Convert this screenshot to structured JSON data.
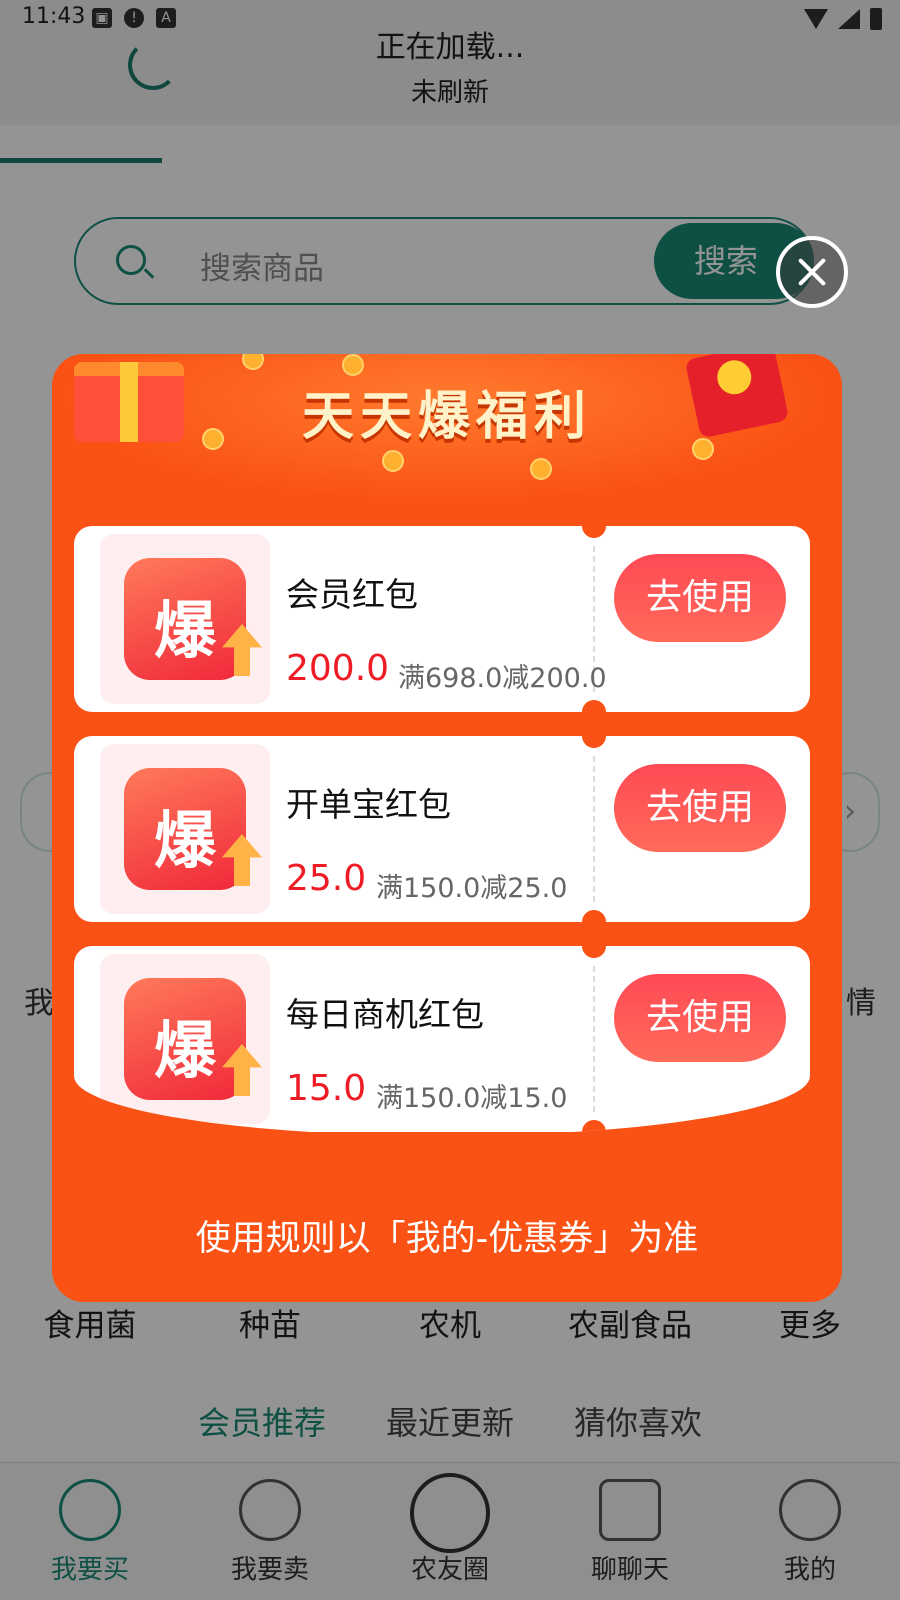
{
  "status_bar": {
    "time": "11:43"
  },
  "refresh": {
    "title": "正在加载...",
    "subtitle": "未刷新"
  },
  "search": {
    "placeholder": "搜索商品",
    "button_label": "搜索"
  },
  "background_labels": {
    "left": "我",
    "right": "情"
  },
  "categories": [
    "食用菌",
    "种苗",
    "农机",
    "农副食品",
    "更多"
  ],
  "sub_tabs": [
    {
      "label": "会员推荐",
      "active": true
    },
    {
      "label": "最近更新",
      "active": false
    },
    {
      "label": "猜你喜欢",
      "active": false
    }
  ],
  "bottom_nav": [
    {
      "label": "我要买",
      "icon": "dollar-coins-icon",
      "active": true
    },
    {
      "label": "我要卖",
      "icon": "money-bag-icon",
      "active": false
    },
    {
      "label": "农友圈",
      "icon": "aperture-icon",
      "active": false
    },
    {
      "label": "聊聊天",
      "icon": "chat-bubble-icon",
      "active": false
    },
    {
      "label": "我的",
      "icon": "person-icon",
      "active": false
    }
  ],
  "popup": {
    "title": "天天爆福利",
    "footer": "使用规则以「我的-优惠券」为准",
    "coupons": [
      {
        "icon_char": "爆",
        "name": "会员红包",
        "amount": "200.0",
        "condition": "满698.0减200.0",
        "button_label": "去使用"
      },
      {
        "icon_char": "爆",
        "name": "开单宝红包",
        "amount": "25.0",
        "condition": "满150.0减25.0",
        "button_label": "去使用"
      },
      {
        "icon_char": "爆",
        "name": "每日商机红包",
        "amount": "15.0",
        "condition": "满150.0减15.0",
        "button_label": "去使用"
      }
    ]
  },
  "colors": {
    "accent": "#1a8a78",
    "popup_bg": "#fa5114",
    "price": "#ee1c25"
  }
}
